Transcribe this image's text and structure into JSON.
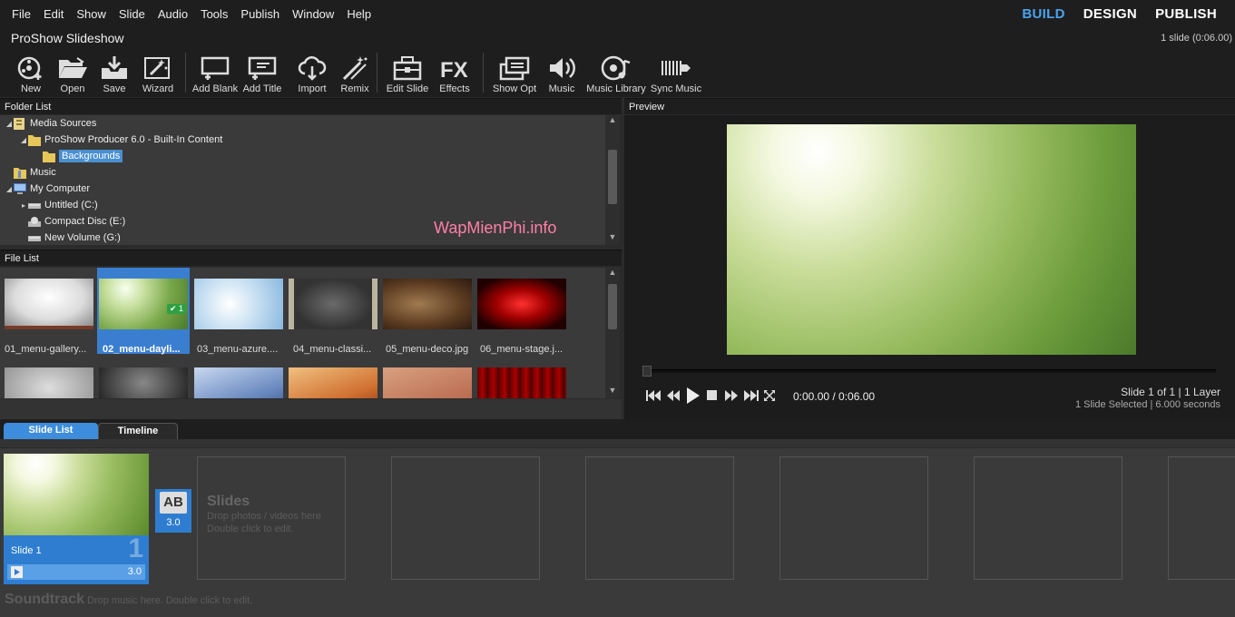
{
  "menu": [
    "File",
    "Edit",
    "Show",
    "Slide",
    "Audio",
    "Tools",
    "Publish",
    "Window",
    "Help"
  ],
  "modes": {
    "build": "BUILD",
    "design": "DESIGN",
    "publish": "PUBLISH"
  },
  "title": "ProShow Slideshow",
  "slide_count": "1 slide (0:06.00)",
  "toolbar": {
    "new": "New",
    "open": "Open",
    "save": "Save",
    "wizard": "Wizard",
    "add_blank": "Add Blank",
    "add_title": "Add Title",
    "import": "Import",
    "remix": "Remix",
    "edit_slide": "Edit Slide",
    "effects": "Effects",
    "show_opt": "Show Opt",
    "music": "Music",
    "music_library": "Music Library",
    "sync_music": "Sync Music"
  },
  "folder_list": {
    "header": "Folder List",
    "items": [
      "Media Sources",
      "ProShow Producer 6.0 - Built-In Content",
      "Backgrounds",
      "Music",
      "My Computer",
      "Untitled (C:)",
      "Compact Disc (E:)",
      "New Volume (G:)"
    ]
  },
  "watermark": "WapMienPhi.info",
  "file_list": {
    "header": "File List",
    "files": [
      "01_menu-gallery...",
      "02_menu-dayli...",
      "03_menu-azure....",
      "04_menu-classi...",
      "05_menu-deco.jpg",
      "06_menu-stage.j..."
    ],
    "selected_badge": "1"
  },
  "preview": {
    "header": "Preview",
    "timecode": "0:00.00 / 0:06.00",
    "slide_of": "Slide 1 of 1  |  1 Layer",
    "selected_info": "1 Slide Selected  |  6.000 seconds"
  },
  "tabs": {
    "slide_list": "Slide List",
    "timeline": "Timeline"
  },
  "storyboard": {
    "slide_name": "Slide 1",
    "slide_number": "1",
    "slide_duration": "3.0",
    "transition_label": "AB",
    "transition_duration": "3.0",
    "slides_heading": "Slides",
    "slides_hint1": "Drop photos / videos here",
    "slides_hint2": "Double click to edit.",
    "soundtrack_heading": "Soundtrack",
    "soundtrack_hint": "Drop music here.  Double click to edit."
  },
  "colors": {
    "accent": "#3d8ddc",
    "build_mode": "#4aa3f0",
    "watermark": "#ff7fa8",
    "check_badge": "#2ea043"
  }
}
